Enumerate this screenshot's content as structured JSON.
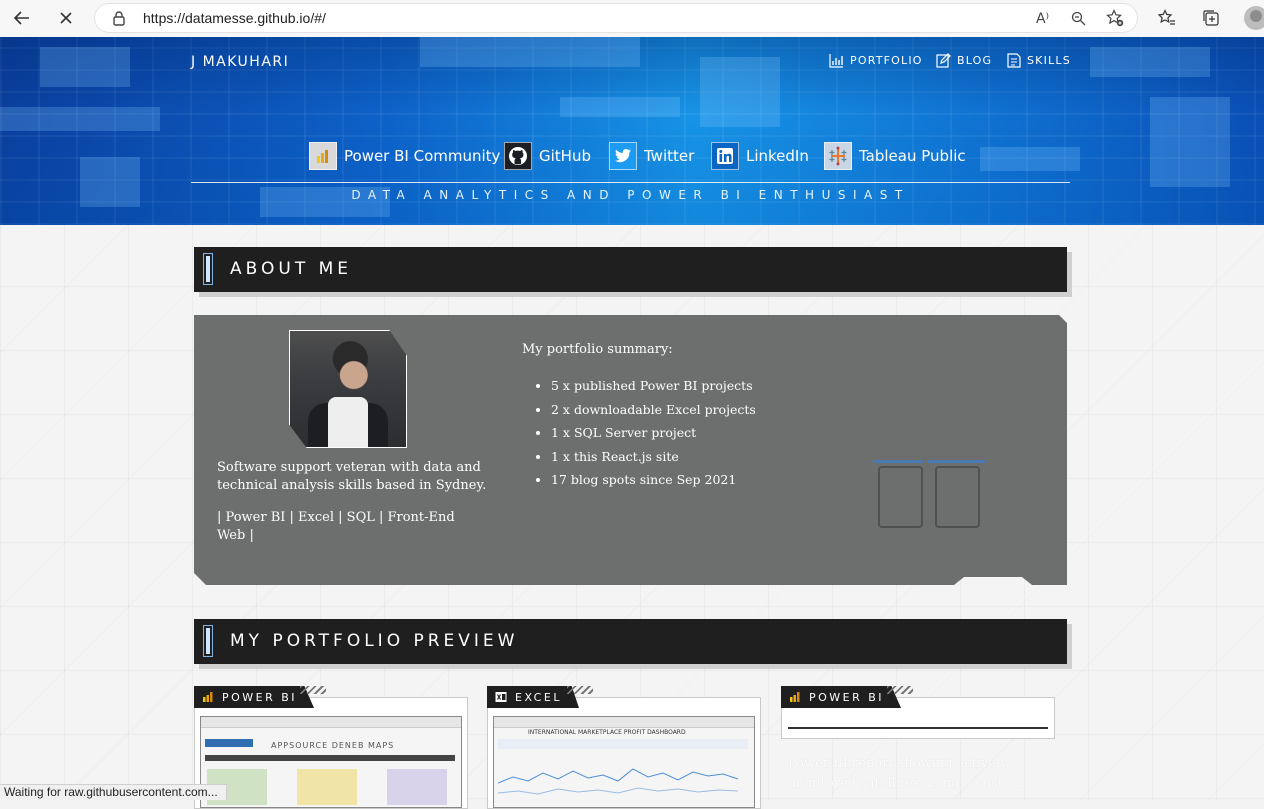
{
  "browser": {
    "url": "https://datamesse.github.io/#/",
    "status_text": "Waiting for raw.githubusercontent.com..."
  },
  "header": {
    "site_name": "J MAKUHARI",
    "nav": [
      {
        "label": "PORTFOLIO",
        "icon": "chart-icon"
      },
      {
        "label": "BLOG",
        "icon": "edit-icon"
      },
      {
        "label": "SKILLS",
        "icon": "document-icon"
      }
    ],
    "social": [
      {
        "label": "Power BI Community",
        "icon": "powerbi-icon"
      },
      {
        "label": "GitHub",
        "icon": "github-icon"
      },
      {
        "label": "Twitter",
        "icon": "twitter-icon"
      },
      {
        "label": "LinkedIn",
        "icon": "linkedin-icon"
      },
      {
        "label": "Tableau Public",
        "icon": "tableau-icon"
      }
    ],
    "tagline": "DATA ANALYTICS AND POWER BI ENTHUSIAST"
  },
  "about": {
    "heading": "ABOUT ME",
    "bio": "Software support veteran with data and technical analysis skills based in Sydney.",
    "skills": "| Power BI | Excel | SQL | Front-End Web |",
    "summary_title": "My portfolio summary:",
    "summary_items": [
      "5 x published Power BI projects",
      "2 x downloadable Excel projects",
      "1 x SQL Server project",
      "1 x this React.js site",
      "17 blog spots since Sep 2021"
    ]
  },
  "portfolio": {
    "heading": "MY PORTFOLIO PREVIEW",
    "cards": [
      {
        "tag": "POWER BI",
        "icon": "powerbi-icon",
        "preview_title": "APPSOURCE DENEB MAPS"
      },
      {
        "tag": "EXCEL",
        "icon": "excel-icon",
        "preview_title": "INTERNATIONAL MARKETPLACE PROFIT DASHBOARD"
      },
      {
        "tag": "POWER BI",
        "icon": "powerbi-icon",
        "description": "Power BI report showing actively monitored satellites using a custom"
      }
    ]
  },
  "colors": {
    "hero_blue": "#0d61c8",
    "section_dark": "#1f1f1f",
    "card_grey": "#6d6e6e"
  }
}
